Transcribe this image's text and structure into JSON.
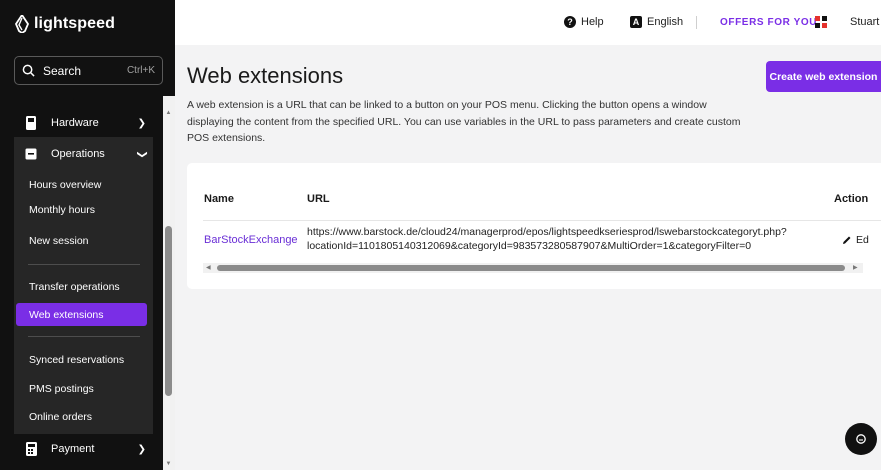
{
  "brand": {
    "name": "lightspeed"
  },
  "search": {
    "label": "Search",
    "shortcut": "Ctrl+K"
  },
  "sidebar": {
    "hardware": {
      "label": "Hardware"
    },
    "operations": {
      "label": "Operations"
    },
    "operations_items": [
      {
        "label": "Hours overview"
      },
      {
        "label": "Monthly hours"
      },
      {
        "label": "New session"
      },
      {
        "label": "Transfer operations"
      },
      {
        "label": "Web extensions",
        "active": true
      },
      {
        "label": "Synced reservations"
      },
      {
        "label": "PMS postings"
      },
      {
        "label": "Online orders"
      }
    ],
    "payment": {
      "label": "Payment"
    }
  },
  "topbar": {
    "help": "Help",
    "language": "English",
    "offers": "OFFERS FOR YOU",
    "user": "Stuart"
  },
  "page": {
    "title": "Web extensions",
    "create_button": "Create web extension",
    "description": "A web extension is a URL that can be linked to a button on your POS menu. Clicking the button opens a window displaying the content from the specified URL. You can use variables in the URL to pass parameters and create custom POS extensions."
  },
  "table": {
    "columns": [
      "Name",
      "URL",
      "Action"
    ],
    "rows": [
      {
        "name": "BarStockExchange",
        "url": "https://www.barstock.de/cloud24/managerprod/epos/lightspeedkseriesprod/lswebarstockcategoryt.php?locationId=1101805140312069&categoryId=983573280587907&MultiOrder=1&categoryFilter=0",
        "action": "Ed"
      }
    ]
  },
  "colors": {
    "accent": "#7a2ee6",
    "sidebar_bg": "#111111"
  },
  "icons": [
    "lightspeed-logo-icon",
    "search-icon",
    "hardware-icon",
    "operations-icon",
    "payment-icon",
    "help-icon",
    "language-icon",
    "apps-grid-icon",
    "edit-icon",
    "chat-icon"
  ]
}
